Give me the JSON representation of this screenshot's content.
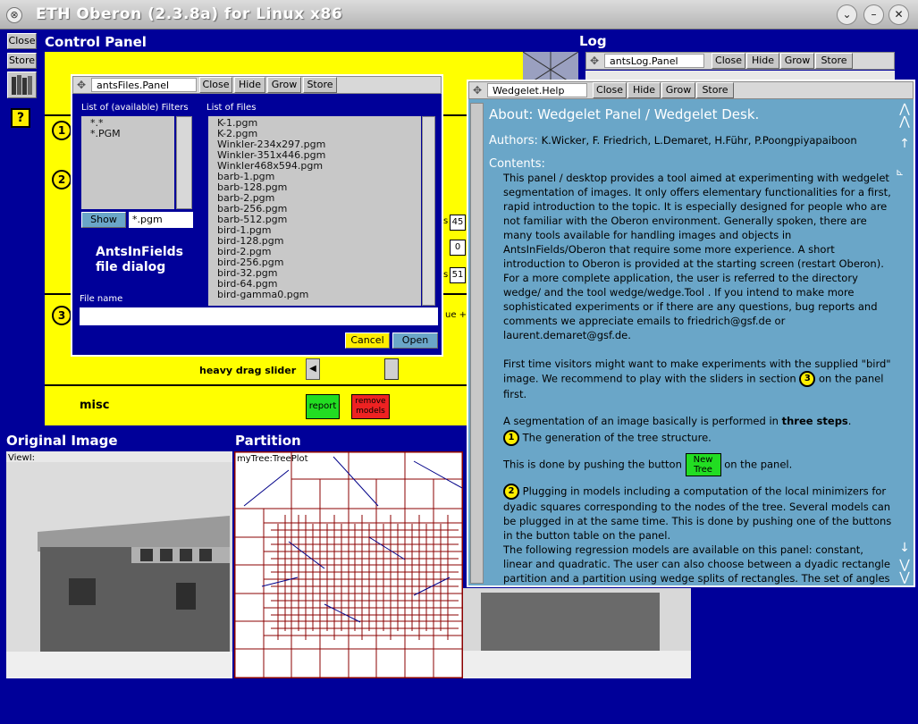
{
  "window": {
    "title": "ETH Oberon (2.3.8a) for Linux x86"
  },
  "left_tools": {
    "close": "Close",
    "store": "Store",
    "help": "?"
  },
  "control_panel": {
    "title": "Control Panel",
    "step1": "1",
    "step2": "2",
    "step3": "3",
    "field_45": "45",
    "field_0": "0",
    "field_51": "51",
    "cut_s1": "s",
    "cut_s3": "s",
    "cut_ue": "ue +",
    "slider_label": "heavy drag slider",
    "misc_label": "misc",
    "report_btn": "report",
    "remove_btn": "remove models"
  },
  "log": {
    "title": "Log",
    "name": "antsLog.Panel",
    "close": "Close",
    "hide": "Hide",
    "grow": "Grow",
    "store": "Store"
  },
  "files_dialog": {
    "name": "antsFiles.Panel",
    "close": "Close",
    "hide": "Hide",
    "grow": "Grow",
    "store": "Store",
    "filters_label": "List of (available) Filters",
    "filters": [
      "*.*",
      "*.PGM"
    ],
    "files_label": "List of Files",
    "files": [
      "K-1.pgm",
      "K-2.pgm",
      "Winkler-234x297.pgm",
      "Winkler-351x446.pgm",
      "Winkler468x594.pgm",
      "barb-1.pgm",
      "barb-128.pgm",
      "barb-2.pgm",
      "barb-256.pgm",
      "barb-512.pgm",
      "bird-1.pgm",
      "bird-128.pgm",
      "bird-2.pgm",
      "bird-256.pgm",
      "bird-32.pgm",
      "bird-64.pgm",
      "bird-gamma0.pgm"
    ],
    "show_btn": "Show",
    "filter_value": "*.pgm",
    "caption_line1": "AntsInFields",
    "caption_line2": "file dialog",
    "filename_label": "File name",
    "filename_value": "",
    "cancel_btn": "Cancel",
    "open_btn": "Open"
  },
  "help": {
    "name": "Wedgelet.Help",
    "close": "Close",
    "hide": "Hide",
    "grow": "Grow",
    "store": "Store",
    "heading": "About: Wedgelet Panel / Wedgelet Desk.",
    "authors_label": "Authors:",
    "authors": "K.Wicker, F. Friedrich, L.Demaret, H.Führ, P.Poongpiyapaiboon",
    "contents_label": "Contents:",
    "p1": "This panel / desktop provides a tool aimed at experimenting with wedgelet segmentation of images. It only offers elementary functionalities for a first, rapid introduction to the topic. It is especially designed for people who are not familiar with the Oberon environment. Generally spoken, there are many tools available for handling images and objects in AntsInFields/Oberon that require some more experience. A short introduction to Oberon is provided at the starting screen (restart Oberon).",
    "p2": "For a more complete application, the user is referred to the directory wedge/ and the tool wedge/wedge.Tool . If you intend to make more sophisticated experiments or if there are any questions, bug reports and comments we appreciate emails to friedrich@gsf.de or laurent.demaret@gsf.de.",
    "p3a": "First time visitors might want to make experiments with the supplied \"bird\" image. We recommend to play with the sliders in section",
    "p3b": "on the panel first.",
    "p4a": "A segmentation of an image basically is performed in",
    "p4b": "three steps",
    "p4c": ".",
    "s1": "The generation of the tree structure.",
    "s1b_a": "This is done by pushing the button",
    "s1b_btn": "New Tree",
    "s1b_b": "on the panel.",
    "s2": "Plugging in models including a computation of the local minimizers for dyadic squares corresponding to the nodes of the tree. Several models can be plugged in at the same time. This is done by pushing one of the buttons in the button table on the panel.",
    "p5": "The following regression models are available on this panel: constant, linear and quadratic. The user can also choose between a dyadic rectangle partition and a partition using wedge splits of rectangles. The set of angles for these wedges can be specified explicitely (wedge model explicit), or equally spaced"
  },
  "original_image": {
    "title": "Original Image",
    "viewer_label": "ViewI:"
  },
  "partition": {
    "title": "Partition",
    "viewer_label": "myTree:TreePlot"
  },
  "colors": {
    "background": "#000099",
    "panel_yellow": "#ffff00",
    "help_bg": "#6aa6c8",
    "tree_lines": "#8b0000"
  }
}
